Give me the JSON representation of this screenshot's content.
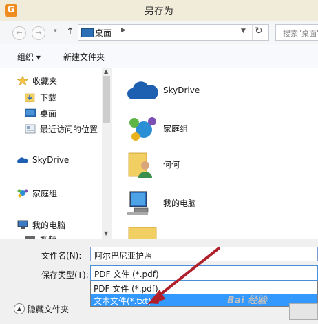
{
  "window": {
    "title": "另存为",
    "app_icon_letter": "G"
  },
  "nav_bar": {
    "breadcrumb": [
      "桌面"
    ],
    "search_placeholder": "搜索\"桌面\""
  },
  "toolbar": {
    "organize": "组织 ▾",
    "new_folder": "新建文件夹"
  },
  "sidebar": {
    "favorites": "收藏夹",
    "items": [
      "下载",
      "桌面",
      "最近访问的位置"
    ],
    "skydrive": "SkyDrive",
    "homegroup": "家庭组",
    "computer": "我的电脑",
    "partial": "视频"
  },
  "files": [
    "SkyDrive",
    "家庭组",
    "何何",
    "我的电脑"
  ],
  "form": {
    "filename_label": "文件名(N):",
    "filename_value": "阿尔巴尼亚护照",
    "filetype_label": "保存类型(T):",
    "filetype_value": "PDF 文件 (*.pdf)",
    "options": [
      "PDF 文件 (*.pdf)",
      "文本文件(*.txt)"
    ]
  },
  "hide_folders": "隐藏文件夹",
  "watermark": "Bai 经验",
  "colors": {
    "accent": "#3399ff",
    "arrow": "#b0202a",
    "title_bg": "#f1ecd9"
  }
}
